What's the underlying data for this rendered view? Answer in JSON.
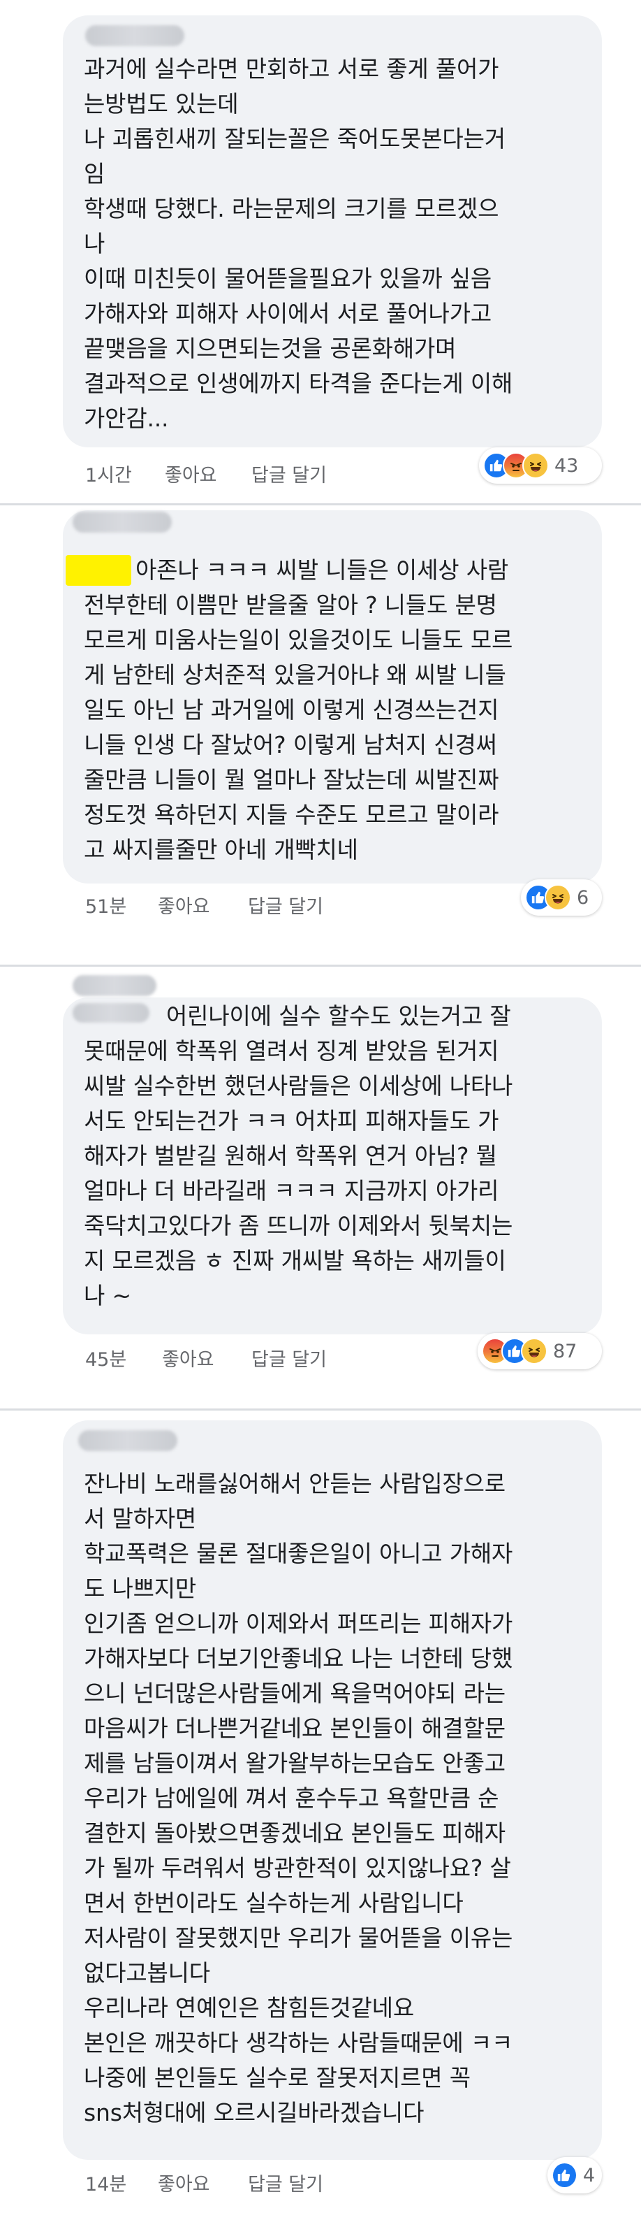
{
  "colors": {
    "bubble_bg": "#f0f2f5",
    "text": "#1c1e21",
    "meta": "#65676b",
    "like_blue": "#1877f2",
    "highlight": "#fff200"
  },
  "comments": [
    {
      "lines": [
        "과거에 실수라면 만회하고 서로 좋게 풀어가",
        "는방법도 있는데",
        "나 괴롭힌새끼 잘되는꼴은 죽어도못본다는거",
        "임",
        "학생때 당했다. 라는문제의 크기를 모르겠으",
        "나",
        "이때 미친듯이 물어뜯을필요가 있을까 싶음",
        "가해자와 피해자 사이에서 서로 풀어나가고",
        "끝맺음을 지으면되는것을 공론화해가며",
        "결과적으로 인생에까지 타격을 준다는게 이해",
        "가안감..."
      ],
      "time": "1시간",
      "like": "좋아요",
      "reply": "답글 달기",
      "reactions": [
        "like-icon",
        "angry-icon",
        "haha-icon"
      ],
      "count": "43"
    },
    {
      "lines": [
        "아존나 ㅋㅋㅋ 씨발 니들은 이세상 사람",
        "전부한테 이쁨만 받을줄 알아 ? 니들도 분명",
        "모르게 미움사는일이 있을것이도 니들도 모르",
        "게 남한테 상처준적 있을거아냐 왜 씨발 니들",
        "일도 아닌 남 과거일에 이렇게 신경쓰는건지",
        "니들 인생 다 잘났어? 이렇게 남처지 신경써",
        "줄만큼 니들이 뭘 얼마나 잘났는데 씨발진짜",
        "정도껏 욕하던지 지들 수준도 모르고 말이라",
        "고 싸지를줄만 아네 개빡치네"
      ],
      "time": "51분",
      "like": "좋아요",
      "reply": "답글 달기",
      "reactions": [
        "like-icon",
        "haha-icon"
      ],
      "count": "6"
    },
    {
      "lines": [
        "어린나이에 실수 할수도 있는거고 잘",
        "못때문에 학폭위 열려서 징계 받았음 된거지",
        "씨발 실수한번 했던사람들은 이세상에 나타나",
        "서도 안되는건가 ㅋㅋ 어차피 피해자들도 가",
        "해자가 벌받길 원해서 학폭위 연거 아님?  뭘",
        "얼마나 더 바라길래 ㅋㅋㅋ 지금까지 아가리",
        "죽닥치고있다가 좀 뜨니까 이제와서 뒷북치는",
        "지 모르겠음 ㅎ 진짜 개씨발 욕하는 새끼들이",
        "나 ~"
      ],
      "time": "45분",
      "like": "좋아요",
      "reply": "답글 달기",
      "reactions": [
        "angry-icon",
        "like-icon",
        "haha-icon"
      ],
      "count": "87"
    },
    {
      "lines": [
        "잔나비 노래를싫어해서 안듣는 사람입장으로",
        "서 말하자면",
        "학교폭력은 물론 절대좋은일이 아니고 가해자",
        "도 나쁘지만",
        "인기좀 얻으니까 이제와서 퍼뜨리는 피해자가",
        "가해자보다 더보기안좋네요 나는 너한테 당했",
        "으니 넌더많은사람들에게 욕을먹어야되 라는",
        "마음씨가 더나쁜거같네요 본인들이 해결할문",
        "제를 남들이껴서 왈가왈부하는모습도 안좋고",
        "우리가 남에일에 껴서 훈수두고 욕할만큼 순",
        "결한지 돌아봤으면좋겠네요 본인들도 피해자",
        "가 될까 두려워서 방관한적이 있지않나요? 살",
        "면서 한번이라도 실수하는게 사람입니다",
        "저사람이 잘못했지만 우리가 물어뜯을 이유는",
        "없다고봅니다",
        "우리나라 연예인은 참힘든것같네요",
        "본인은 깨끗하다 생각하는 사람들때문에 ㅋㅋ",
        "나중에 본인들도 실수로 잘못저지르면 꼭",
        "sns처형대에 오르시길바라겠습니다"
      ],
      "time": "14분",
      "like": "좋아요",
      "reply": "답글 달기",
      "reactions": [
        "like-icon"
      ],
      "count": "4"
    }
  ]
}
